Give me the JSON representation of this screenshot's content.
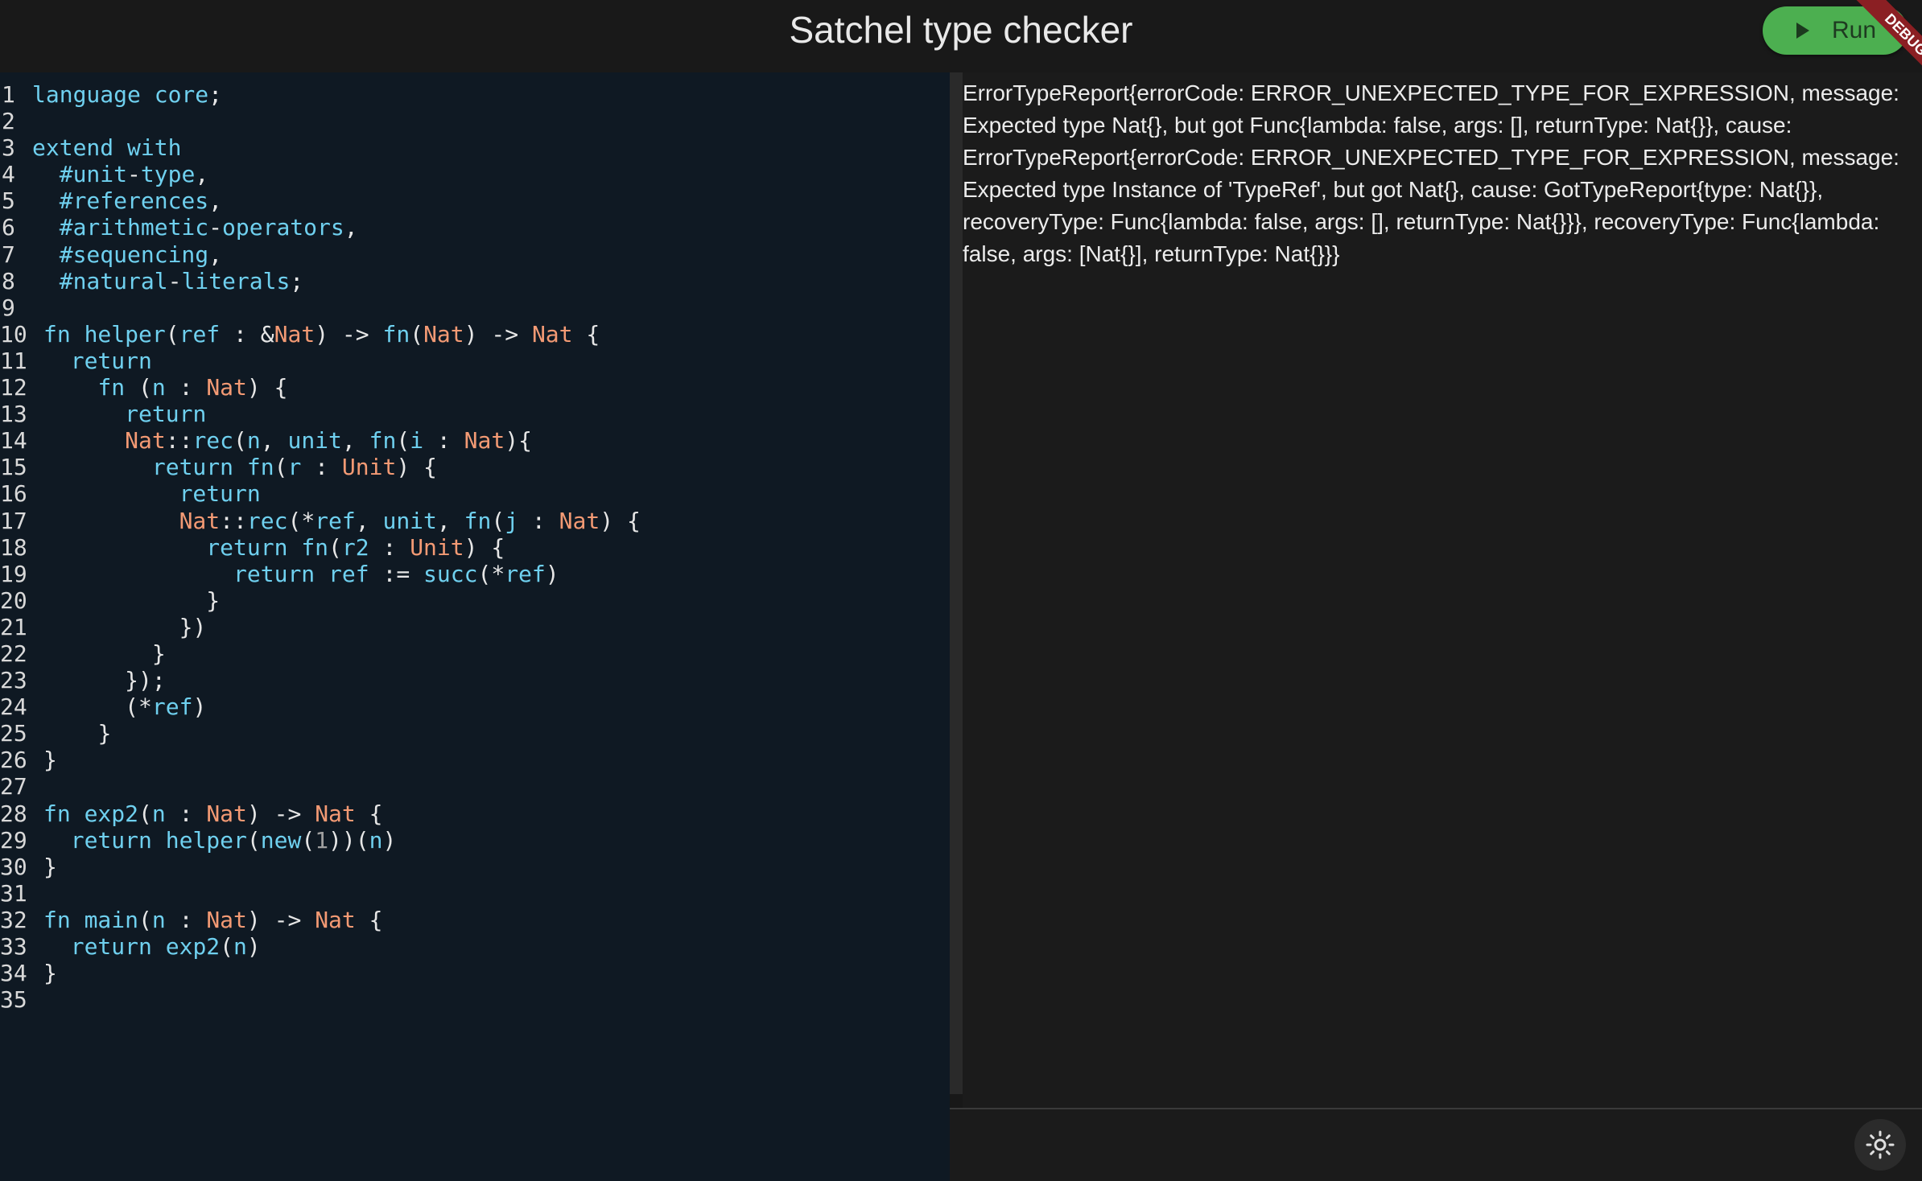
{
  "header": {
    "title": "Satchel type checker",
    "run_label": "Run",
    "debug_label": "DEBUG"
  },
  "editor": {
    "lines": [
      "language core;",
      "",
      "extend with",
      "  #unit-type,",
      "  #references,",
      "  #arithmetic-operators,",
      "  #sequencing,",
      "  #natural-literals;",
      "",
      "fn helper(ref : &Nat) -> fn(Nat) -> Nat {",
      "  return",
      "    fn (n : Nat) {",
      "      return",
      "      Nat::rec(n, unit, fn(i : Nat){",
      "        return fn(r : Unit) {",
      "          return",
      "          Nat::rec(*ref, unit, fn(j : Nat) {",
      "            return fn(r2 : Unit) {",
      "              return ref := succ(*ref)",
      "            }",
      "          })",
      "        }",
      "      });",
      "      (*ref)",
      "    }",
      "}",
      "",
      "fn exp2(n : Nat) -> Nat {",
      "  return helper(new(1))(n)",
      "}",
      "",
      "fn main(n : Nat) -> Nat {",
      "  return exp2(n)",
      "}",
      ""
    ]
  },
  "output": {
    "text": "ErrorTypeReport{errorCode: ERROR_UNEXPECTED_TYPE_FOR_EXPRESSION, message: Expected type Nat{}, but got Func{lambda: false, args: [], returnType: Nat{}}, cause: ErrorTypeReport{errorCode: ERROR_UNEXPECTED_TYPE_FOR_EXPRESSION, message: Expected type Instance of 'TypeRef', but got Nat{}, cause: GotTypeReport{type: Nat{}}, recoveryType: Func{lambda: false, args: [], returnType: Nat{}}}, recoveryType: Func{lambda: false, args: [Nat{}], returnType: Nat{}}}"
  },
  "icons": {
    "run": "play-icon",
    "theme": "sun-icon"
  },
  "colors": {
    "run_button": "#4caf50",
    "keyword": "#6fd0ef",
    "type": "#f39a74",
    "editor_bg": "#0f1923",
    "debug_banner": "#8b1f23"
  }
}
